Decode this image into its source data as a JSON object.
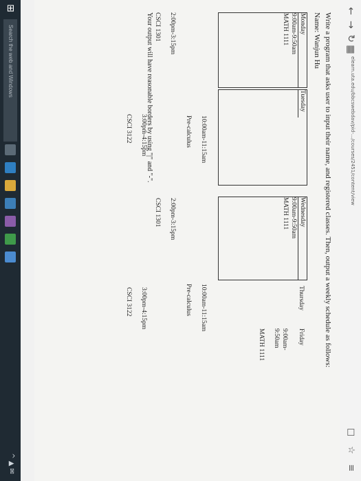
{
  "browser": {
    "url": "elearn.uta.edu/bbcswebdav/pid-.../courses/2451/content/view",
    "back_icon": "arrow-left-icon",
    "forward_icon": "arrow-right-icon",
    "refresh_icon": "refresh-icon",
    "reader_icon": "reading-view-icon",
    "favorites_icon": "star-icon",
    "hub_icon": "hub-icon"
  },
  "page": {
    "instruction": "Write a program that asks user to input their name, and registered classes. Then, output a weekly schedule as follows:",
    "name_line": "Name: Wanjun Hu",
    "schedule": {
      "monday": {
        "header": "Monday",
        "time": "9:00am-9:50am",
        "course": "MATH 1111"
      },
      "tuesday": {
        "header": "Tuesday",
        "time": "10:00am-11:15am",
        "course": "Pre-calculus"
      },
      "wednesday": {
        "header": "Wednesday",
        "time": "9:00am-9:50am",
        "course": "MATH 1111"
      },
      "thursday": {
        "header": "Thursday",
        "time": "10:00am-11:15am",
        "course": "Pre-calculus"
      },
      "friday": {
        "header": "Friday",
        "time": "9:00am-9:50am",
        "course": "MATH 1111"
      },
      "mon_pm": {
        "time": "2:00pm-3:15pm",
        "course": "CSCI 1301"
      },
      "wed_pm": {
        "time": "2:00pm-3:15pm",
        "course": "CSCI 1301"
      },
      "tue_pm": {
        "time": "3:00pm-4:15pm",
        "course": "CSCI 3122"
      },
      "thu_pm": {
        "time": "3:00pm-4:15pm",
        "course": "CSCI 3122"
      }
    },
    "footer": "Your output will have reasonable borders by using \"|\" and \"-\"."
  },
  "taskbar": {
    "search_placeholder": "Search the web and Windows",
    "start_icon": "windows-start-icon",
    "colors": {
      "background": "#1f2a33"
    }
  }
}
